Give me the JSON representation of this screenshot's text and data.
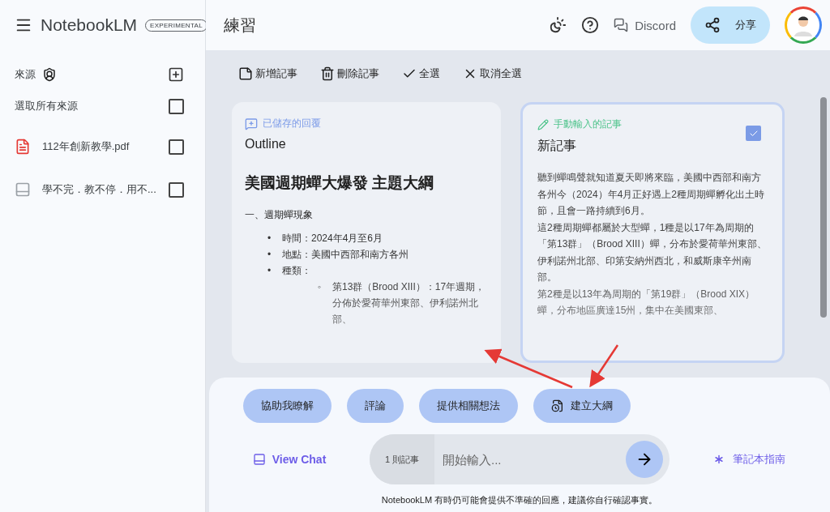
{
  "app": {
    "name": "NotebookLM",
    "badge": "EXPERIMENTAL"
  },
  "sources": {
    "title": "來源",
    "select_all": {
      "label": "選取所有來源",
      "checked": false
    },
    "items": [
      {
        "kind": "pdf",
        "name": "112年創新教學.pdf",
        "checked": false
      },
      {
        "kind": "web",
        "name": "學不完．教不停．用不...",
        "checked": false
      }
    ]
  },
  "header": {
    "title": "練習",
    "discord": "Discord",
    "share": "分享"
  },
  "toolbar": [
    {
      "kind": "add",
      "label": "新增記事"
    },
    {
      "kind": "delete",
      "label": "刪除記事"
    },
    {
      "kind": "check",
      "label": "全選"
    },
    {
      "kind": "close",
      "label": "取消全選"
    }
  ],
  "notes": [
    {
      "kind": "saved",
      "tag": "已儲存的回覆",
      "title": "Outline",
      "selected": false,
      "checked": false,
      "heading": "美國週期蟬大爆發 主題大綱",
      "section": "一、週期蟬現象",
      "bullets": [
        {
          "marker": "•",
          "text": "時間：2024年4月至6月"
        },
        {
          "marker": "•",
          "text": "地點：美國中西部和南方各州"
        },
        {
          "marker": "•",
          "text": "種類：",
          "children": [
            {
              "marker": "◦",
              "text": "第13群（Brood XIII）：17年週期，分佈於愛荷華州東部、伊利諾州北部、"
            }
          ]
        }
      ]
    },
    {
      "kind": "manual",
      "tag": "手動輸入的記事",
      "title": "新記事",
      "selected": true,
      "checked": true,
      "paragraphs": [
        "聽到蟬鳴聲就知道夏天即將來臨，美國中西部和南方各州今（2024）年4月正好遇上2種周期蟬孵化出土時節，且會一路持續到6月。",
        "這2種周期蟬都屬於大型蟬，1種是以17年為周期的「第13群」（Brood XIII）蟬，分布於愛荷華州東部、伊利諾州北部、印第安納州西北，和威斯康辛州南部。",
        "第2種是以13年為周期的「第19群」（Brood XIX）蟬，分布地區廣達15州，集中在美國東部、"
      ]
    }
  ],
  "suggestions": [
    {
      "label": "協助我瞭解"
    },
    {
      "label": "評論"
    },
    {
      "label": "提供相關想法"
    },
    {
      "label": "建立大綱",
      "icon": true
    }
  ],
  "chat": {
    "view_chat": "View Chat",
    "note_count": "1 則記事",
    "placeholder": "開始輸入...",
    "guide": "筆記本指南"
  },
  "disclaimer": "NotebookLM 有時仍可能會提供不準確的回應，建議你自行確認事實。"
}
